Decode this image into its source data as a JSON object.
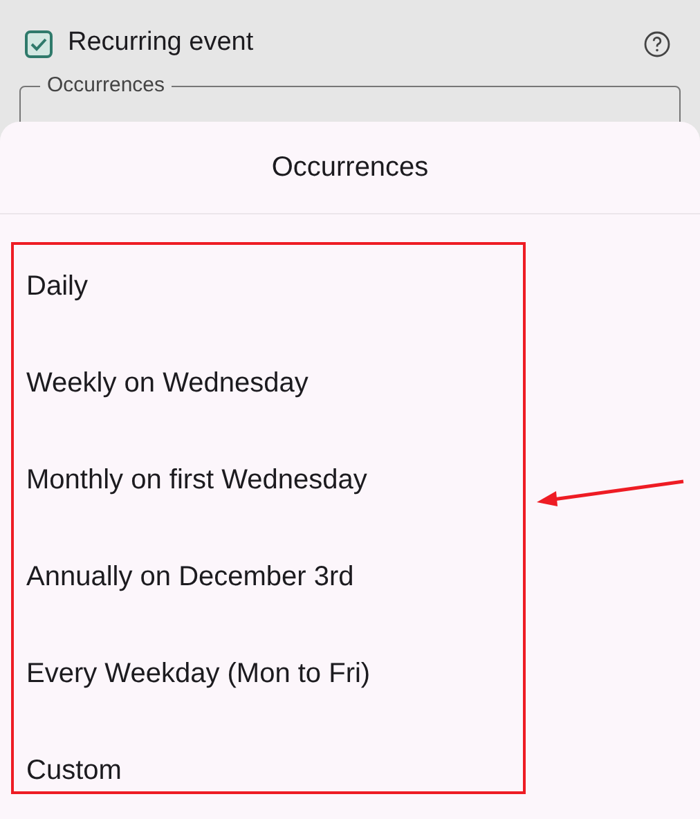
{
  "form": {
    "recurring": {
      "label": "Recurring event",
      "checked": true
    },
    "occurrences_field": {
      "label": "Occurrences"
    }
  },
  "sheet": {
    "title": "Occurrences",
    "options": [
      {
        "label": "Daily"
      },
      {
        "label": "Weekly on Wednesday"
      },
      {
        "label": "Monthly on first Wednesday"
      },
      {
        "label": "Annually on December 3rd"
      },
      {
        "label": "Every Weekday (Mon to Fri)"
      },
      {
        "label": "Custom"
      }
    ]
  }
}
